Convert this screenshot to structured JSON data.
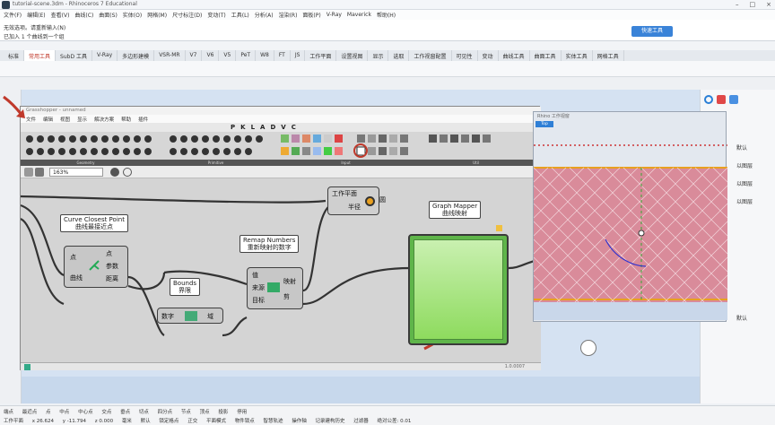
{
  "window": {
    "title": "tutorial-scene.3dm - Rhinoceros 7 Educational",
    "min": "–",
    "max": "□",
    "close": "×"
  },
  "menubar": [
    "文件(F)",
    "编辑(E)",
    "查看(V)",
    "曲线(C)",
    "曲面(S)",
    "实体(O)",
    "网格(M)",
    "尺寸标注(D)",
    "变动(T)",
    "工具(L)",
    "分析(A)",
    "渲染(R)",
    "面板(P)",
    "V-Ray",
    "Maverick",
    "帮助(H)"
  ],
  "command": {
    "line1": "无效选项。请重新输入(N)",
    "line2": "已加入 1 个曲线到一个组",
    "action_button": "快速工具"
  },
  "tabs": [
    "标准",
    "常用工具",
    "SubD 工具",
    "V-Ray",
    "多边形建模",
    "VSR-MR",
    "V7",
    "V6",
    "V5",
    "PeT",
    "W8",
    "FT",
    "JS",
    "工作平面",
    "设置视图",
    "显示",
    "选取",
    "工作视窗配置",
    "可见性",
    "变动",
    "曲线工具",
    "曲面工具",
    "实体工具",
    "网格工具"
  ],
  "active_tab_index": 1,
  "gh": {
    "title": "Grasshopper - unnamed",
    "menu": [
      "文件",
      "编辑",
      "视图",
      "显示",
      "解决方案",
      "帮助",
      "插件"
    ],
    "tabs": [
      "P",
      "K",
      "L",
      "A",
      "D",
      "V",
      "C"
    ],
    "ribbon_groups": [
      "Geometry",
      "Primitive",
      "Input",
      "Util"
    ],
    "zoom": "163%",
    "status": "1.0.0007",
    "components": {
      "curve_closest_point": {
        "title": "Curve Closest Point",
        "subtitle": "曲线最接近点",
        "inputs": [
          "点",
          "曲线"
        ],
        "outputs": [
          "点",
          "参数",
          "距离"
        ]
      },
      "bounds": {
        "title": "Bounds",
        "subtitle": "界限",
        "inputs": [
          "数字"
        ],
        "outputs": [
          "域"
        ]
      },
      "remap": {
        "title": "Remap Numbers",
        "subtitle": "重新映射的数字",
        "inputs": [
          "值",
          "来源",
          "目标"
        ],
        "outputs": [
          "映射",
          "剪"
        ]
      },
      "plane": {
        "title": "工作平面",
        "input": "半径",
        "output": "圆"
      },
      "graph_mapper": {
        "title": "Graph Mapper",
        "subtitle": "曲线映射"
      }
    }
  },
  "preview": {
    "title": "Rhino 工作视窗",
    "button": "Top"
  },
  "rightpanel": [
    "默认",
    "以图层",
    "以图层",
    "以图层",
    "默认"
  ],
  "statusbar": {
    "row1": [
      "端点",
      "最近点",
      "点",
      "中点",
      "中心点",
      "交点",
      "垂点",
      "切点",
      "四分点",
      "节点",
      "顶点",
      "投影",
      "停用"
    ],
    "row2": [
      "工作平面",
      "x 26.624",
      "y -11.794",
      "z 0.000",
      "毫米",
      "默认",
      "锁定格点",
      "正交",
      "平面模式",
      "物件锁点",
      "智慧轨迹",
      "操作轴",
      "记录建构历史",
      "过滤器",
      "绝对公差: 0.01"
    ]
  },
  "colors": {
    "accent": "#c0392b",
    "graph": "#8edb5e",
    "grid": "#d4d4d4",
    "preview_pink": "#d98b9a"
  }
}
